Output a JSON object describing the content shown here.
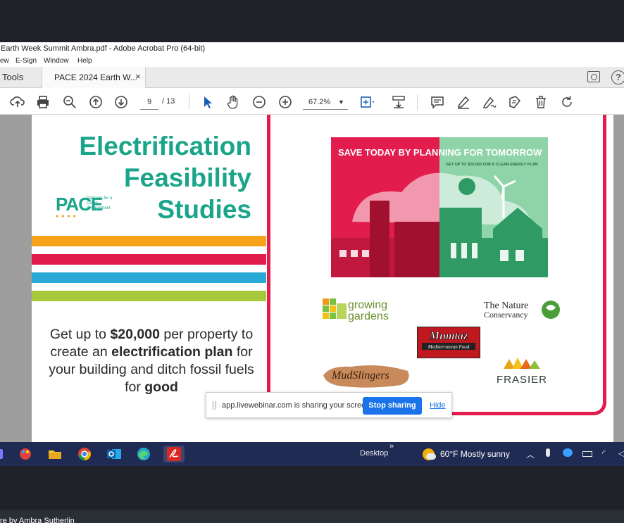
{
  "window": {
    "title": "Earth Week Summit Ambra.pdf - Adobe Acrobat Pro (64-bit)",
    "menu": [
      "ew",
      "E-Sign",
      "Window",
      "Help"
    ]
  },
  "tabs": {
    "tools": "Tools",
    "document": "PACE 2024 Earth W...",
    "close": "×"
  },
  "toolbar": {
    "page_current": "9",
    "page_total": "/ 13",
    "zoom": "67.2%"
  },
  "slide": {
    "title_lines": [
      "Electrification",
      "Feasibility",
      "Studies"
    ],
    "pace_logo": {
      "wordmark": "PACE",
      "tagline": "Partners for a Clean Environment"
    },
    "body": {
      "part1": "Get up to ",
      "amount": "$20,000",
      "part2": " per property to create an ",
      "plan": "electrification plan",
      "part3": " for your building and ditch fossil fuels for ",
      "good": "good"
    },
    "hero": {
      "headline": "SAVE TODAY BY PLANNING FOR TOMORROW",
      "subline": "GET UP TO $20,000 FOR A CLEAN ENERGY PLAN"
    },
    "sponsors": {
      "growing_gardens": [
        "growing",
        "gardens"
      ],
      "nature_conservancy": [
        "The Nature",
        "Conservancy"
      ],
      "mumtaz": [
        "Mumtaz",
        "Mediterranean Food"
      ],
      "mudslingers": "MudSlingers",
      "frasier": "FRASIER"
    },
    "colors": {
      "teal": "#1aa58a",
      "red": "#e21c4d",
      "orange": "#f7a21b",
      "blue": "#29a9d6",
      "lime": "#a6c93b"
    }
  },
  "share_bar": {
    "message": "app.livewebinar.com is sharing your screen.",
    "stop": "Stop sharing",
    "hide": "Hide"
  },
  "taskbar": {
    "desktop": "Desktop",
    "chevron": "»",
    "weather": "60°F  Mostly sunny"
  },
  "bottom_caption": "re by Ambra Sutherlin"
}
